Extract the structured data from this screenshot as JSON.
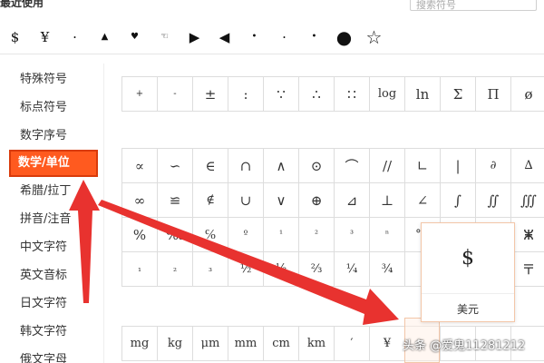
{
  "header": {
    "recent_title": "最近使用",
    "search_placeholder": "搜索符号"
  },
  "recent": [
    "$",
    "¥",
    "·",
    "▲",
    "♥",
    "☜",
    "▶",
    "◀",
    "•",
    "·",
    "•",
    "●",
    "☆"
  ],
  "sidebar": {
    "items": [
      {
        "label": "特殊符号",
        "active": false
      },
      {
        "label": "标点符号",
        "active": false
      },
      {
        "label": "数字序号",
        "active": false
      },
      {
        "label": "数学/单位",
        "active": true
      },
      {
        "label": "希腊/拉丁",
        "active": false
      },
      {
        "label": "拼音/注音",
        "active": false
      },
      {
        "label": "中文字符",
        "active": false
      },
      {
        "label": "英文音标",
        "active": false
      },
      {
        "label": "日文字符",
        "active": false
      },
      {
        "label": "韩文字符",
        "active": false
      },
      {
        "label": "俄文字母",
        "active": false
      }
    ]
  },
  "grid_top": [
    [
      "+",
      "-",
      "±",
      ":",
      "∵",
      "∴",
      "∷",
      "log",
      "ln",
      "Σ",
      "Π",
      "ø"
    ]
  ],
  "grid_math": [
    [
      "∝",
      "∽",
      "∈",
      "∩",
      "∧",
      "⊙",
      "⌒",
      "//",
      "∟",
      "|",
      "∂",
      "∆"
    ],
    [
      "∞",
      "≌",
      "∉",
      "∪",
      "∨",
      "⊕",
      "⊿",
      "⊥",
      "∠",
      "∫",
      "∬",
      "∭"
    ],
    [
      "%",
      "‰",
      "℅",
      "º",
      "¹",
      "²",
      "³",
      "ⁿ",
      "℃",
      "",
      "",
      "ⵥ"
    ],
    [
      "₁",
      "₂",
      "₃",
      "½",
      "⅓",
      "⅔",
      "¼",
      "¾",
      "°",
      "",
      "",
      "〒"
    ]
  ],
  "grid_units": [
    [
      "mg",
      "kg",
      "μm",
      "mm",
      "cm",
      "km",
      "′",
      "¥",
      "",
      "",
      "",
      ""
    ]
  ],
  "popup": {
    "symbol": "$",
    "name": "美元"
  },
  "watermark": "头条 @爱鬼11281212",
  "colors": {
    "accent": "#ff5a1f",
    "arrow": "#e8322f"
  }
}
